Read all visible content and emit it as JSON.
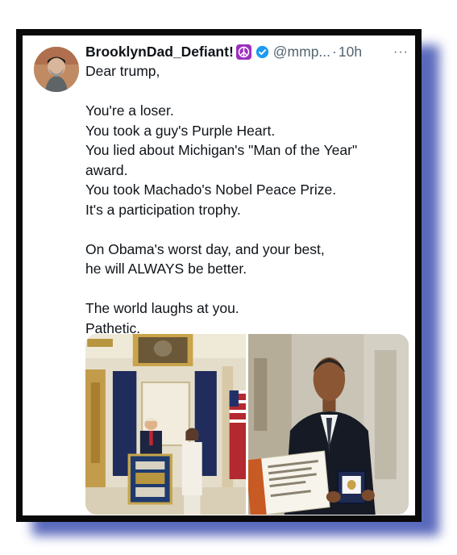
{
  "tweet": {
    "author": {
      "display_name": "BrooklynDad_Defiant!",
      "peace_badge": "☮",
      "handle": "@mmp...",
      "separator": "·",
      "time": "10h"
    },
    "more_label": "···",
    "text_lines": [
      "Dear trump,",
      "",
      "You're a loser.",
      "You took a guy's Purple Heart.",
      "You lied about Michigan's \"Man of the Year\"",
      "award.",
      "You took Machado's Nobel Peace Prize.",
      "It's a participation trophy.",
      "",
      "On Obama's worst day, and your best,",
      "he will ALWAYS be better.",
      "",
      "The world laughs at you.",
      "Pathetic."
    ]
  },
  "colors": {
    "frame": "#0a0a0a",
    "shadow": "#3d4fb0",
    "verified": "#1d9bf0",
    "peace_badge": "#9b2fbf",
    "secondary_text": "#536471"
  },
  "icons": [
    "peace-symbol-icon",
    "verified-badge-icon",
    "more-options-icon"
  ]
}
